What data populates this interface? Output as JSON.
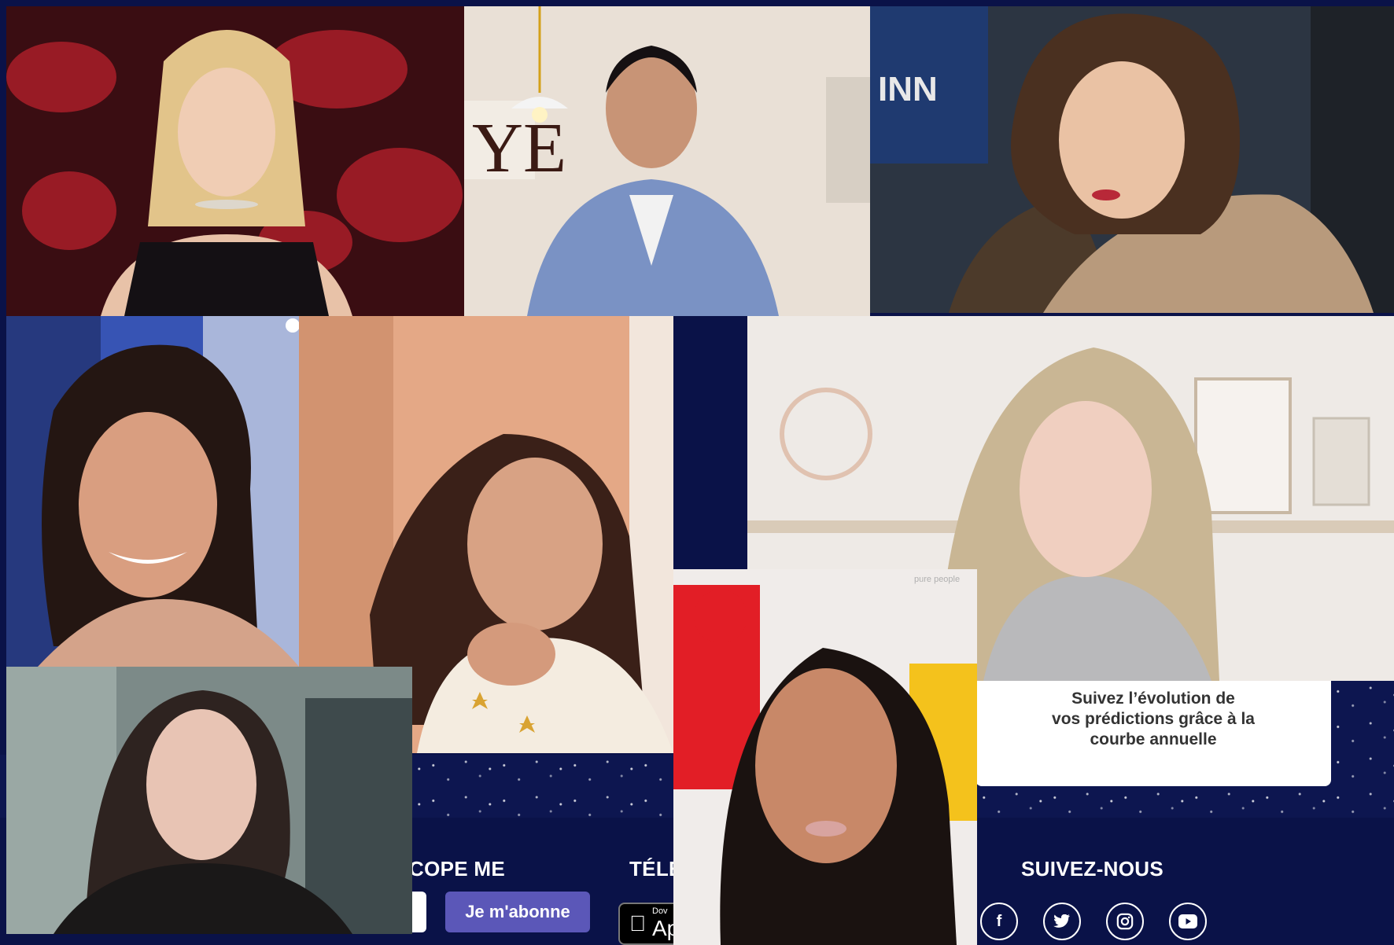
{
  "promo": {
    "text": "Suivez l’évolution de\nvos prédictions grâce à la\ncourbe annuelle"
  },
  "footer": {
    "newsletter_heading": "COPE ME",
    "subscribe_label": "Je m'abonne",
    "download_heading": "TÉLÉ",
    "appstore_small": "Dov",
    "appstore_label": "App",
    "follow_heading": "SUIVEZ-NOUS",
    "social_icons": [
      "facebook-icon",
      "twitter-icon",
      "instagram-icon",
      "youtube-icon"
    ]
  },
  "photos": {
    "count": 9,
    "watermark": "pure people"
  },
  "colors": {
    "navy": "#0a1248",
    "button": "#5b57b8"
  }
}
